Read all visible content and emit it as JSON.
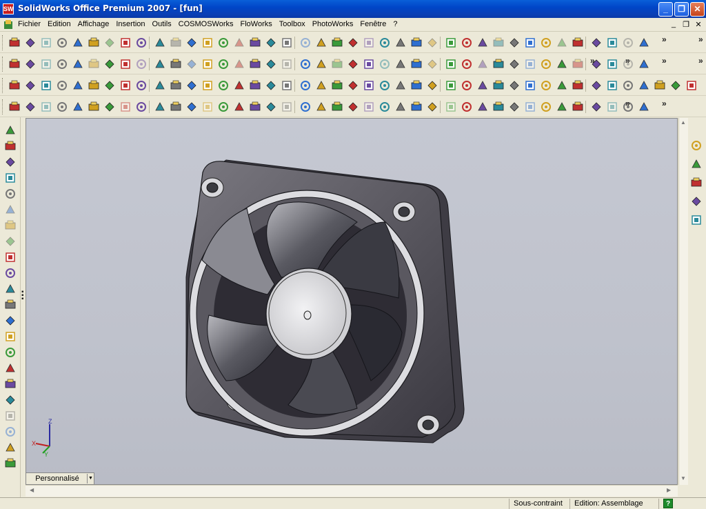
{
  "window": {
    "title": "SolidWorks Office Premium 2007 - [fun]",
    "app_icon_text": "SW"
  },
  "title_buttons": {
    "minimize": "_",
    "maximize": "❐",
    "close": "✕"
  },
  "menu": {
    "items": [
      "Fichier",
      "Edition",
      "Affichage",
      "Insertion",
      "Outils",
      "COSMOSWorks",
      "FloWorks",
      "Toolbox",
      "PhotoWorks",
      "Fenêtre",
      "?"
    ],
    "mdi": [
      "_",
      "❐",
      "✕"
    ]
  },
  "triad": {
    "x": "X",
    "y": "Y",
    "z": "Z"
  },
  "bottom": {
    "config_tab": "Personnalisé"
  },
  "status": {
    "state": "Sous-contraint",
    "mode": "Edition: Assemblage",
    "help": "?"
  },
  "colors": {
    "titlebar": "#0a4fd0",
    "viewport": "#c2c5cf",
    "chrome": "#ece9d8"
  }
}
